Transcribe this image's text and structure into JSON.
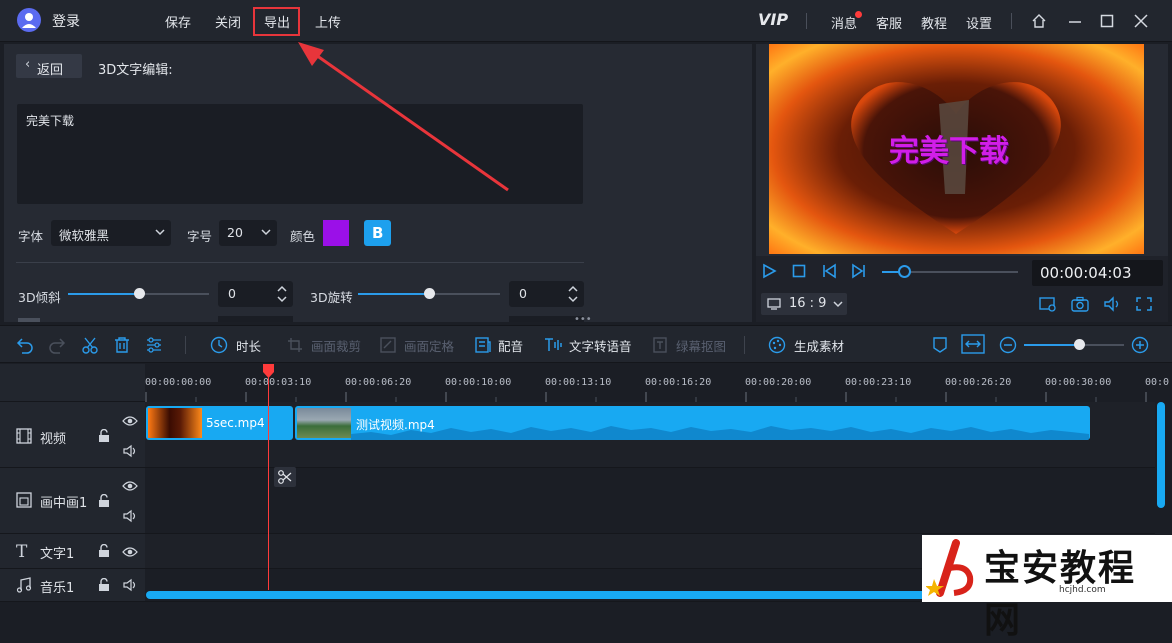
{
  "topbar": {
    "login": "登录",
    "menu": [
      "保存",
      "关闭",
      "导出",
      "上传"
    ],
    "vip": "VIP",
    "right_menu": [
      "消息",
      "客服",
      "教程",
      "设置"
    ]
  },
  "editor": {
    "back": "返回",
    "title": "3D文字编辑:",
    "text_value": "完美下载",
    "font_label": "字体",
    "font_value": "微软雅黑",
    "size_label": "字号",
    "size_value": "20",
    "color_label": "颜色",
    "color_value": "#9b10e8",
    "bold_label": "B",
    "tilt_label": "3D倾斜",
    "tilt_value": "0",
    "tilt_level": 0.5,
    "rotate_label": "3D旋转",
    "rotate_value": "0",
    "rotate_level": 0.5
  },
  "preview": {
    "overlay_text": "完美下载",
    "time": "00:00:04:03",
    "ratio": "16 : 9"
  },
  "toolbar": {
    "duration": "时长",
    "crop": "画面裁剪",
    "freeze": "画面定格",
    "dub": "配音",
    "tts": "文字转语音",
    "matting": "绿幕抠图",
    "generate": "生成素材"
  },
  "timeline": {
    "ticks": [
      "00:00:00:00",
      "00:00:03:10",
      "00:00:06:20",
      "00:00:10:00",
      "00:00:13:10",
      "00:00:16:20",
      "00:00:20:00",
      "00:00:23:10",
      "00:00:26:20",
      "00:00:30:00",
      "00:0"
    ],
    "tracks": [
      "视频",
      "画中画1",
      "文字1",
      "音乐1"
    ],
    "clips": [
      "5sec.mp4",
      "测试视频.mp4"
    ]
  },
  "watermark": {
    "title": "宝安教程网",
    "url": "hcjhd.com"
  },
  "colors": {
    "accent": "#18a9f2",
    "highlight_box": "#e8353b",
    "playhead": "#ff3b3b"
  }
}
